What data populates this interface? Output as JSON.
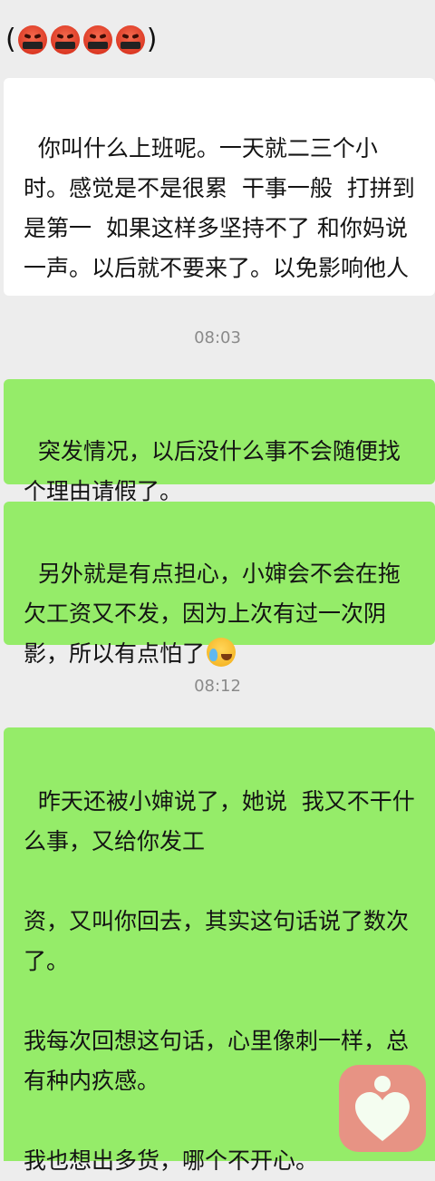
{
  "header": {
    "open_paren": "(",
    "close_paren": ")",
    "emojis": [
      "angry-cursing-face",
      "angry-cursing-face",
      "angry-cursing-face",
      "angry-cursing-face"
    ]
  },
  "messages": [
    {
      "side": "left",
      "text": "你叫什么上班呢。一天就二三个小时。感觉是不是很累  干事一般  打拼到是第一  如果这样多坚持不了 和你妈说一声。以后就不要来了。以免影响他人"
    },
    {
      "time": "08:03"
    },
    {
      "side": "right",
      "text": "突发情况，以后没什么事不会随便找个理由请假了。"
    },
    {
      "side": "right",
      "text": "另外就是有点担心，小婶会不会在拖欠工资又不发，因为上次有过一次阴影，所以有点怕了",
      "emoji": "crying-face"
    },
    {
      "time": "08:12"
    },
    {
      "side": "right",
      "text": "昨天还被小婶说了，她说  我又不干什么事，又给你发工\n\n资，又叫你回去，其实这句话说了数次了。\n\n我每次回想这句话，心里像刺一样，总有种内疚感。\n\n我也想出多货，哪个不开心。"
    }
  ],
  "colors": {
    "background": "#ededed",
    "incoming_bubble": "#ffffff",
    "outgoing_bubble": "#95ec69",
    "timestamp": "#8a8a8a",
    "app_badge": "#f08a88"
  },
  "app_badge_icon": "heart-person-icon"
}
